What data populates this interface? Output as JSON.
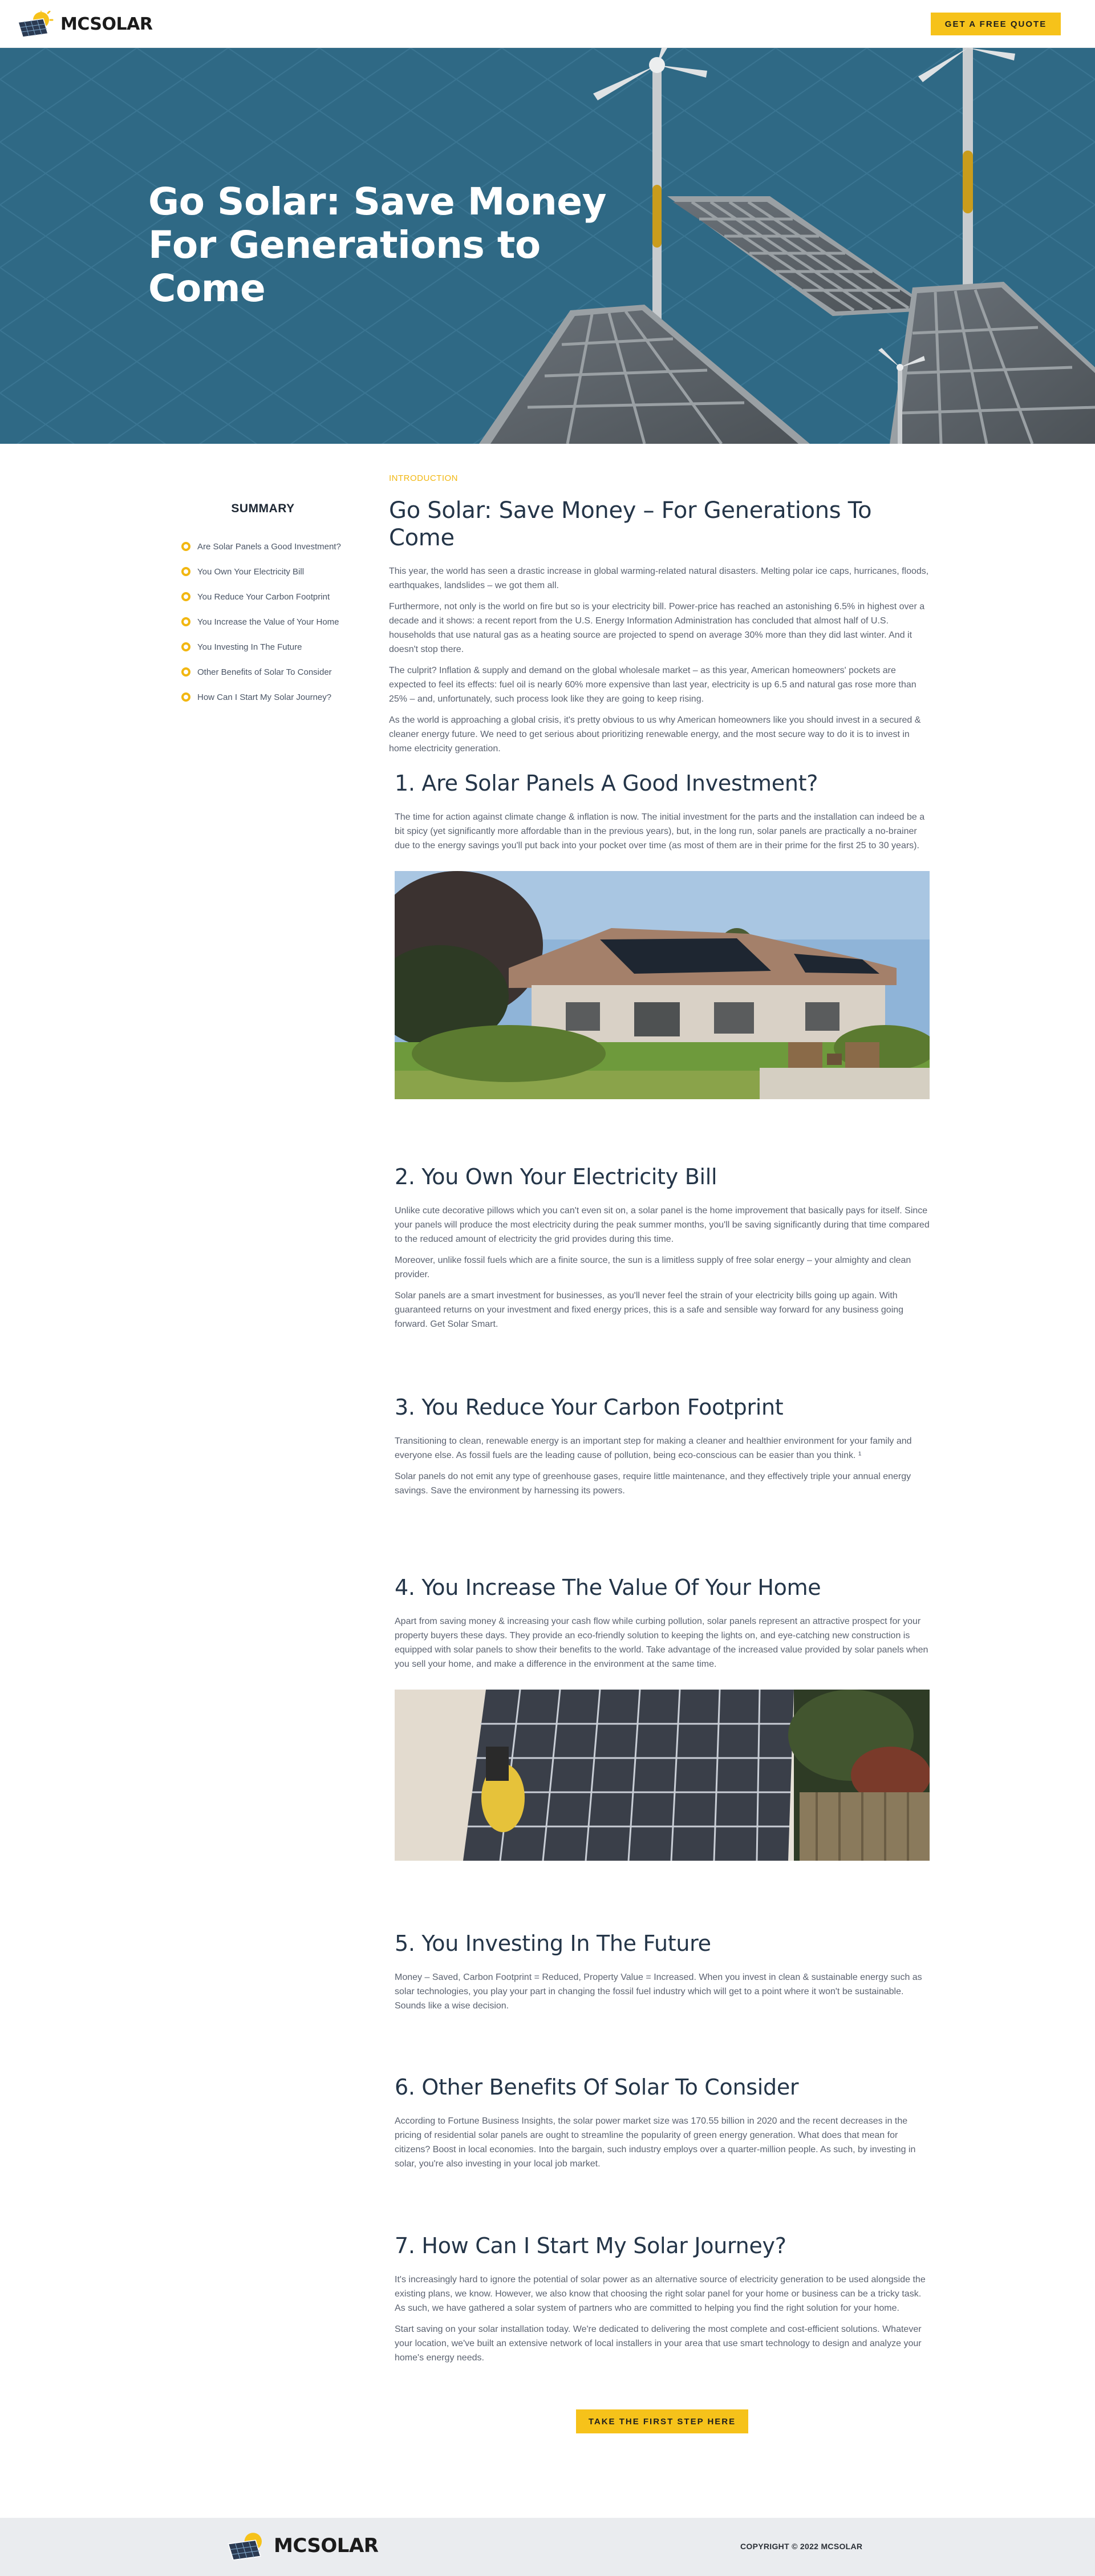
{
  "header": {
    "logo_text": "MCSOLAR",
    "cta_label": "GET A FREE QUOTE"
  },
  "hero": {
    "title": "Go Solar: Save Money For Generations to Come"
  },
  "summary": {
    "title": "SUMMARY",
    "items": [
      "Are Solar Panels a Good Investment?",
      "You Own Your Electricity Bill",
      "You Reduce Your Carbon Footprint",
      "You Increase the Value of Your Home",
      "You Investing In The Future",
      "Other Benefits of Solar To Consider",
      "How Can I Start My Solar Journey?"
    ]
  },
  "intro": {
    "label": "INTRODUCTION",
    "title": "Go Solar: Save Money – For Generations To Come",
    "paragraphs": [
      "This year, the world has seen a drastic increase in global warming-related natural disasters. Melting polar ice caps, hurricanes, floods, earthquakes, landslides – we got them all.",
      "Furthermore, not only is the world on fire but so is your electricity bill. Power-price has reached an astonishing 6.5% in highest over a decade and it shows: a recent report from the U.S. Energy Information Administration has concluded that almost half of U.S. households that use natural gas as a heating source are projected to spend on average 30% more than they did last winter. And it doesn't stop there.",
      "The culprit? Inflation & supply and demand on the global wholesale market – as this year, American homeowners' pockets are expected to feel its effects: fuel oil is nearly 60% more expensive than last year, electricity is up 6.5 and natural gas rose more than 25% – and, unfortunately, such process look like they are going to keep rising.",
      "As the world is approaching a global crisis, it's pretty obvious to us why American homeowners like you should invest in a secured & cleaner energy future. We need to get serious about prioritizing renewable energy, and the most secure way to do it is to invest in home electricity generation."
    ]
  },
  "sections": [
    {
      "heading": "1. Are Solar Panels A Good Investment?",
      "paragraphs": [
        "The time for action against climate change & inflation is now. The initial investment for the parts and the installation can indeed be a bit spicy (yet significantly more affordable than in the previous years), but, in the long run, solar panels are practically a no-brainer due to the energy savings you'll put back into your pocket over time (as most of them are in their prime for the first 25 to 30 years)."
      ]
    },
    {
      "heading": "2. You Own Your Electricity Bill",
      "paragraphs": [
        "Unlike cute decorative pillows which you can't even sit on, a solar panel is the home improvement that basically pays for itself. Since your panels will produce the most electricity during the peak summer months, you'll be saving significantly during that time compared to the reduced amount of electricity the grid provides during this time.",
        "Moreover, unlike fossil fuels which are a finite source, the sun is a limitless supply of free solar energy – your almighty and clean provider.",
        "Solar panels are a smart investment for businesses, as you'll never feel the strain of your electricity bills going up again. With guaranteed returns on your investment and fixed energy prices, this is a safe and sensible way forward for any business going forward. Get Solar Smart."
      ]
    },
    {
      "heading": "3. You Reduce Your Carbon Footprint",
      "paragraphs": [
        "Transitioning to clean, renewable energy is an important step for making a cleaner and healthier environment for your family and everyone else. As fossil fuels are the leading cause of pollution, being eco-conscious can be easier than you think. ¹",
        "Solar panels do not emit any type of greenhouse gases, require little maintenance, and they effectively triple your annual energy savings. Save the environment by harnessing its powers."
      ]
    },
    {
      "heading": "4. You Increase The Value Of Your Home",
      "paragraphs": [
        "Apart from saving money & increasing your cash flow while curbing pollution, solar panels represent an attractive prospect for your property buyers these days. They provide an eco-friendly solution to keeping the lights on, and eye-catching new construction is equipped with solar panels to show their benefits to the world. Take advantage of the increased value provided by solar panels when you sell your home, and make a difference in the environment at the same time."
      ]
    },
    {
      "heading": "5. You Investing In The Future",
      "paragraphs": [
        "Money – Saved, Carbon Footprint = Reduced, Property Value = Increased. When you invest in clean & sustainable energy such as solar technologies, you play your part in changing the fossil fuel industry which will get to a point where it won't be sustainable. Sounds like a wise decision."
      ]
    },
    {
      "heading": "6. Other Benefits Of Solar To Consider",
      "paragraphs": [
        "According to Fortune Business Insights, the solar power market size was 170.55 billion in 2020 and the recent decreases in the pricing of residential solar panels are ought to streamline the popularity of green energy generation. What does that mean for citizens? Boost in local economies. Into the bargain, such industry employs over a quarter-million people. As such, by investing in solar, you're also investing in your local job market."
      ]
    },
    {
      "heading": "7. How Can I Start My Solar Journey?",
      "paragraphs": [
        "It's increasingly hard to ignore the potential of solar power as an alternative source of electricity generation to be used alongside the existing plans, we know. However, we also know that choosing the right solar panel for your home or business can be a tricky task. As such, we have gathered a solar system of partners who are committed to helping you find the right solution for your home.",
        "Start saving on your solar installation today. We're dedicated to delivering the most complete and cost-efficient solutions. Whatever your location, we've built an extensive network of local installers in your area that use smart technology to design and analyze your home's energy needs."
      ]
    }
  ],
  "bottom_cta_label": "TAKE THE FIRST STEP HERE",
  "footer": {
    "logo_text": "MCSOLAR",
    "copyright": "COPYRIGHT © 2022 MCSOLAR"
  },
  "colors": {
    "accent": "#f6c21a",
    "hero_bg": "#2f6985",
    "heading": "#243548",
    "footer_bg": "#eaecef"
  },
  "icons": [
    "solar-panel-logo-icon",
    "bullet-dot-icon"
  ]
}
